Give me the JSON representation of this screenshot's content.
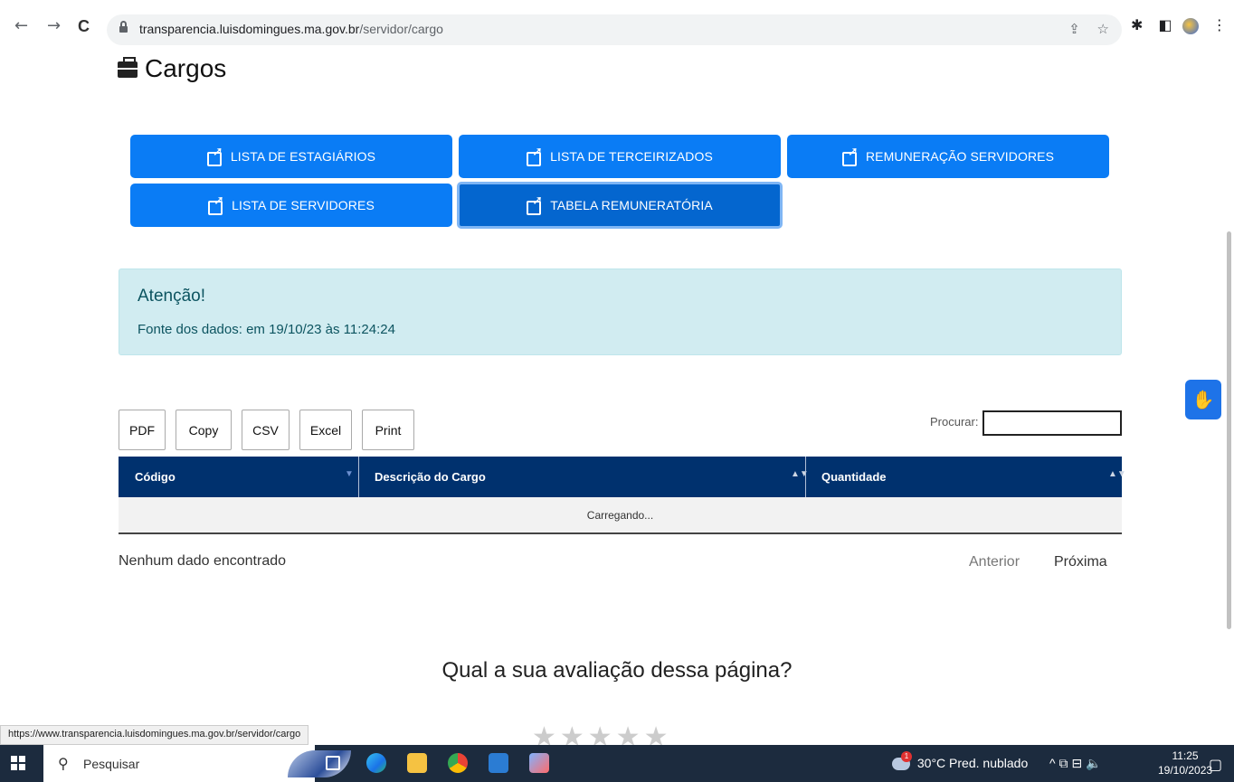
{
  "browser": {
    "url_domain": "transparencia.luisdomingues.ma.gov.br",
    "url_path": "/servidor/cargo",
    "back_icon": "←",
    "forward_icon": "→",
    "reload_icon": "C",
    "share_icon": "⇪",
    "star_icon": "☆",
    "extensions_icon": "✱",
    "sidepanel_icon": "◧",
    "menu_icon": "⋮"
  },
  "page": {
    "title": "Cargos",
    "buttons": [
      {
        "label": "LISTA DE ESTAGIÁRIOS"
      },
      {
        "label": "LISTA DE TERCEIRIZADOS"
      },
      {
        "label": "REMUNERAÇÃO SERVIDORES"
      },
      {
        "label": "LISTA DE SERVIDORES"
      },
      {
        "label": "TABELA REMUNERATÓRIA"
      }
    ],
    "alert": {
      "heading": "Atenção!",
      "text": "Fonte dos dados: em 19/10/23 às 11:24:24"
    },
    "toolbar": [
      "PDF",
      "Copy",
      "CSV",
      "Excel",
      "Print"
    ],
    "search_label": "Procurar:",
    "table": {
      "columns": [
        "Código",
        "Descrição do Cargo",
        "Quantidade"
      ],
      "loading": "Carregando..."
    },
    "info": "Nenhum dado encontrado",
    "pager": {
      "prev": "Anterior",
      "next": "Próxima"
    },
    "rating_question": "Qual a sua avaliação dessa página?",
    "stars": "★★★★★",
    "vlibras_icon": "✋"
  },
  "status_bar_url": "https://www.transparencia.luisdomingues.ma.gov.br/servidor/cargo",
  "taskbar": {
    "search_placeholder": "Pesquisar",
    "search_icon": "⚲",
    "weather": "30°C  Pred. nublado",
    "weather_badge": "1",
    "tray_icons": "^  ⧉  ⊟  🔈",
    "time": "11:25",
    "date": "19/10/2023",
    "notification_icon": "▢"
  },
  "colors": {
    "primary": "#0a7cf5",
    "table_header": "#00316e",
    "alert_bg": "#d1ecf1",
    "taskbar": "#1c2b3e"
  }
}
